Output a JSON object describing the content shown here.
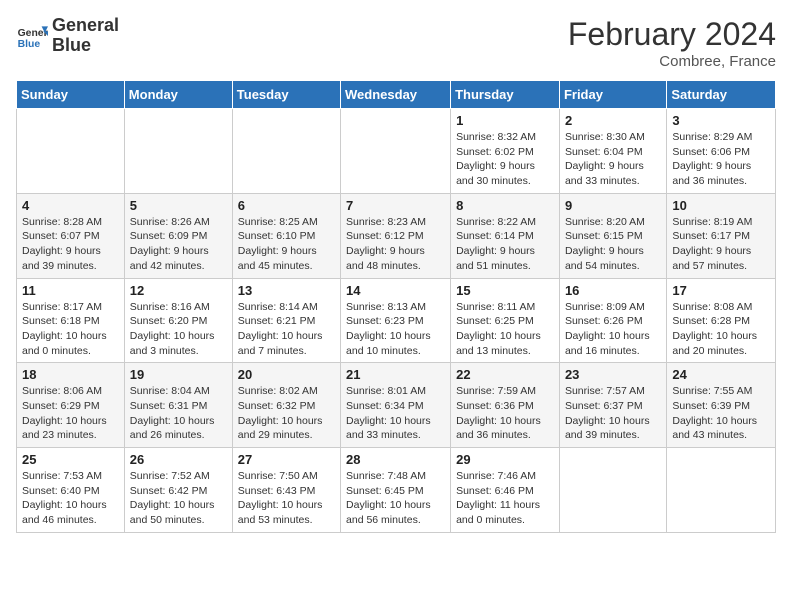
{
  "logo": {
    "line1": "General",
    "line2": "Blue"
  },
  "title": "February 2024",
  "subtitle": "Combree, France",
  "days_of_week": [
    "Sunday",
    "Monday",
    "Tuesday",
    "Wednesday",
    "Thursday",
    "Friday",
    "Saturday"
  ],
  "weeks": [
    [
      {
        "num": "",
        "info": ""
      },
      {
        "num": "",
        "info": ""
      },
      {
        "num": "",
        "info": ""
      },
      {
        "num": "",
        "info": ""
      },
      {
        "num": "1",
        "info": "Sunrise: 8:32 AM\nSunset: 6:02 PM\nDaylight: 9 hours and 30 minutes."
      },
      {
        "num": "2",
        "info": "Sunrise: 8:30 AM\nSunset: 6:04 PM\nDaylight: 9 hours and 33 minutes."
      },
      {
        "num": "3",
        "info": "Sunrise: 8:29 AM\nSunset: 6:06 PM\nDaylight: 9 hours and 36 minutes."
      }
    ],
    [
      {
        "num": "4",
        "info": "Sunrise: 8:28 AM\nSunset: 6:07 PM\nDaylight: 9 hours and 39 minutes."
      },
      {
        "num": "5",
        "info": "Sunrise: 8:26 AM\nSunset: 6:09 PM\nDaylight: 9 hours and 42 minutes."
      },
      {
        "num": "6",
        "info": "Sunrise: 8:25 AM\nSunset: 6:10 PM\nDaylight: 9 hours and 45 minutes."
      },
      {
        "num": "7",
        "info": "Sunrise: 8:23 AM\nSunset: 6:12 PM\nDaylight: 9 hours and 48 minutes."
      },
      {
        "num": "8",
        "info": "Sunrise: 8:22 AM\nSunset: 6:14 PM\nDaylight: 9 hours and 51 minutes."
      },
      {
        "num": "9",
        "info": "Sunrise: 8:20 AM\nSunset: 6:15 PM\nDaylight: 9 hours and 54 minutes."
      },
      {
        "num": "10",
        "info": "Sunrise: 8:19 AM\nSunset: 6:17 PM\nDaylight: 9 hours and 57 minutes."
      }
    ],
    [
      {
        "num": "11",
        "info": "Sunrise: 8:17 AM\nSunset: 6:18 PM\nDaylight: 10 hours and 0 minutes."
      },
      {
        "num": "12",
        "info": "Sunrise: 8:16 AM\nSunset: 6:20 PM\nDaylight: 10 hours and 3 minutes."
      },
      {
        "num": "13",
        "info": "Sunrise: 8:14 AM\nSunset: 6:21 PM\nDaylight: 10 hours and 7 minutes."
      },
      {
        "num": "14",
        "info": "Sunrise: 8:13 AM\nSunset: 6:23 PM\nDaylight: 10 hours and 10 minutes."
      },
      {
        "num": "15",
        "info": "Sunrise: 8:11 AM\nSunset: 6:25 PM\nDaylight: 10 hours and 13 minutes."
      },
      {
        "num": "16",
        "info": "Sunrise: 8:09 AM\nSunset: 6:26 PM\nDaylight: 10 hours and 16 minutes."
      },
      {
        "num": "17",
        "info": "Sunrise: 8:08 AM\nSunset: 6:28 PM\nDaylight: 10 hours and 20 minutes."
      }
    ],
    [
      {
        "num": "18",
        "info": "Sunrise: 8:06 AM\nSunset: 6:29 PM\nDaylight: 10 hours and 23 minutes."
      },
      {
        "num": "19",
        "info": "Sunrise: 8:04 AM\nSunset: 6:31 PM\nDaylight: 10 hours and 26 minutes."
      },
      {
        "num": "20",
        "info": "Sunrise: 8:02 AM\nSunset: 6:32 PM\nDaylight: 10 hours and 29 minutes."
      },
      {
        "num": "21",
        "info": "Sunrise: 8:01 AM\nSunset: 6:34 PM\nDaylight: 10 hours and 33 minutes."
      },
      {
        "num": "22",
        "info": "Sunrise: 7:59 AM\nSunset: 6:36 PM\nDaylight: 10 hours and 36 minutes."
      },
      {
        "num": "23",
        "info": "Sunrise: 7:57 AM\nSunset: 6:37 PM\nDaylight: 10 hours and 39 minutes."
      },
      {
        "num": "24",
        "info": "Sunrise: 7:55 AM\nSunset: 6:39 PM\nDaylight: 10 hours and 43 minutes."
      }
    ],
    [
      {
        "num": "25",
        "info": "Sunrise: 7:53 AM\nSunset: 6:40 PM\nDaylight: 10 hours and 46 minutes."
      },
      {
        "num": "26",
        "info": "Sunrise: 7:52 AM\nSunset: 6:42 PM\nDaylight: 10 hours and 50 minutes."
      },
      {
        "num": "27",
        "info": "Sunrise: 7:50 AM\nSunset: 6:43 PM\nDaylight: 10 hours and 53 minutes."
      },
      {
        "num": "28",
        "info": "Sunrise: 7:48 AM\nSunset: 6:45 PM\nDaylight: 10 hours and 56 minutes."
      },
      {
        "num": "29",
        "info": "Sunrise: 7:46 AM\nSunset: 6:46 PM\nDaylight: 11 hours and 0 minutes."
      },
      {
        "num": "",
        "info": ""
      },
      {
        "num": "",
        "info": ""
      }
    ]
  ]
}
